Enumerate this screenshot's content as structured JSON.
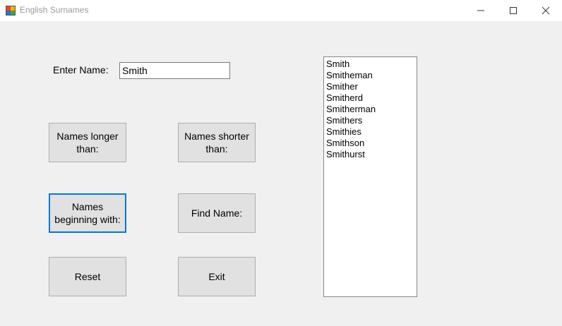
{
  "window": {
    "title": "English Surnames",
    "controls": [
      "minimize-icon",
      "maximize-icon",
      "close-icon"
    ]
  },
  "form": {
    "enter_name_label": "Enter Name:",
    "name_value": "Smith"
  },
  "buttons": {
    "longer": "Names longer than:",
    "shorter": "Names shorter than:",
    "beginning": "Names beginning with:",
    "find": "Find Name:",
    "reset": "Reset",
    "exit": "Exit"
  },
  "results": [
    "Smith",
    "Smitheman",
    "Smither",
    "Smitherd",
    "Smitherman",
    "Smithers",
    "Smithies",
    "Smithson",
    "Smithurst"
  ],
  "colors": {
    "background": "#f0f0f0",
    "focus_border": "#0078d7",
    "button_face": "#e1e1e1"
  }
}
